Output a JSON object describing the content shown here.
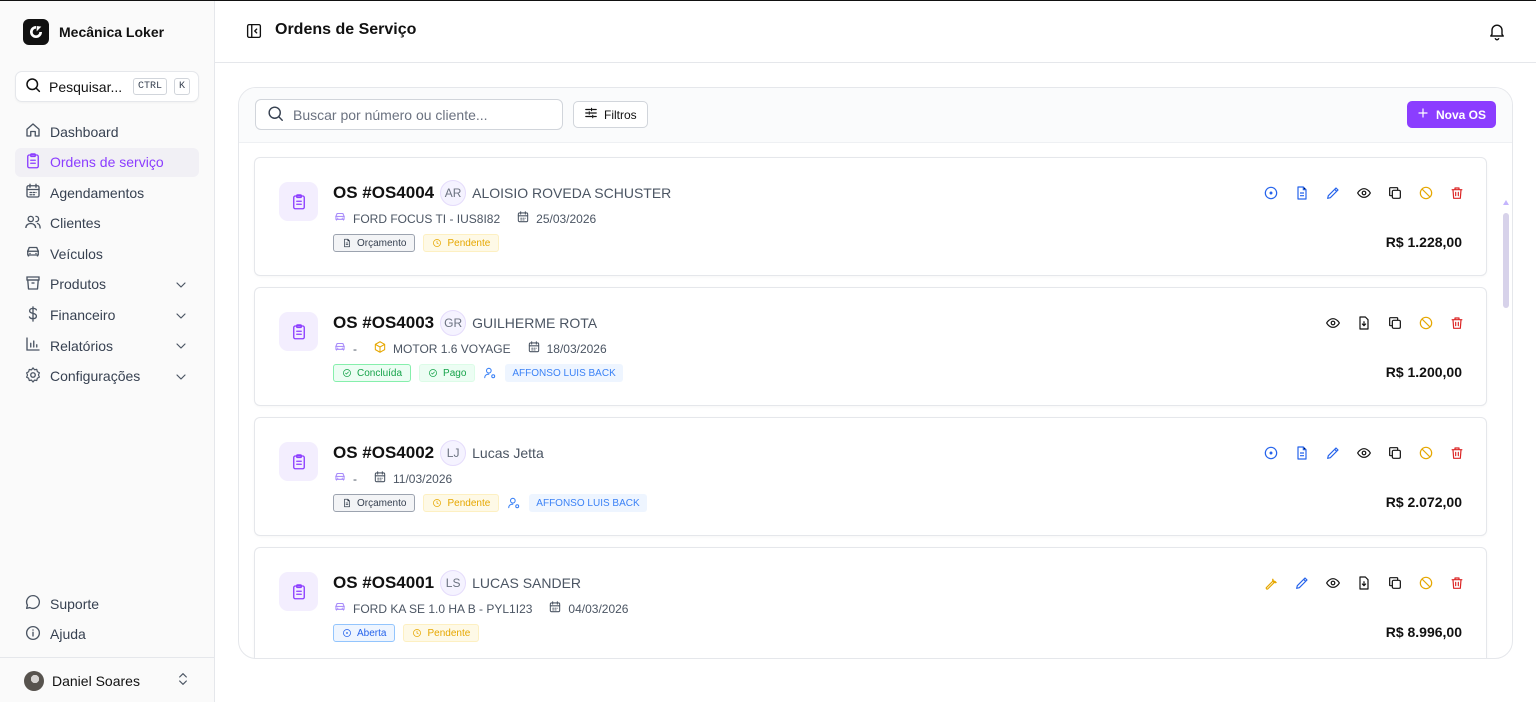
{
  "app": {
    "name": "Mecânica Loker"
  },
  "sidebar": {
    "search": {
      "label": "Pesquisar...",
      "kbd1": "CTRL",
      "kbd2": "K"
    },
    "items": [
      {
        "label": "Dashboard",
        "icon": "home-icon"
      },
      {
        "label": "Ordens de serviço",
        "icon": "clipboard-icon",
        "active": true
      },
      {
        "label": "Agendamentos",
        "icon": "calendar-icon"
      },
      {
        "label": "Clientes",
        "icon": "users-icon"
      },
      {
        "label": "Veículos",
        "icon": "car-icon"
      },
      {
        "label": "Produtos",
        "icon": "package-icon",
        "expandable": true
      },
      {
        "label": "Financeiro",
        "icon": "dollar-icon",
        "expandable": true
      },
      {
        "label": "Relatórios",
        "icon": "bar-chart-icon",
        "expandable": true
      },
      {
        "label": "Configurações",
        "icon": "settings-icon",
        "expandable": true
      }
    ],
    "bottom": [
      {
        "label": "Suporte",
        "icon": "message-icon"
      },
      {
        "label": "Ajuda",
        "icon": "info-icon"
      }
    ],
    "user": {
      "name": "Daniel Soares"
    }
  },
  "header": {
    "title": "Ordens de Serviço"
  },
  "toolbar": {
    "search_placeholder": "Buscar por número ou cliente...",
    "filters_label": "Filtros",
    "new_label": "Nova OS"
  },
  "colors": {
    "accent": "#8b3dff",
    "pending": "#e6a700",
    "success": "#16a34a",
    "info": "#2563eb",
    "danger": "#dc2626"
  },
  "orders": [
    {
      "number": "OS #OS4004",
      "initials": "AR",
      "client": "ALOISIO ROVEDA SCHUSTER",
      "vehicle": "FORD FOCUS TI - IUS8I82",
      "date": "25/03/2026",
      "status": "Orçamento",
      "payment": "Pendente",
      "total": "R$ 1.228,00"
    },
    {
      "number": "OS #OS4003",
      "initials": "GR",
      "client": "GUILHERME ROTA",
      "vehicle": "-",
      "item": "MOTOR 1.6 VOYAGE",
      "date": "18/03/2026",
      "status": "Concluída",
      "payment": "Pago",
      "technician": "AFFONSO LUIS BACK",
      "total": "R$ 1.200,00"
    },
    {
      "number": "OS #OS4002",
      "initials": "LJ",
      "client": "Lucas Jetta",
      "vehicle": "-",
      "date": "11/03/2026",
      "status": "Orçamento",
      "payment": "Pendente",
      "technician": "AFFONSO LUIS BACK",
      "total": "R$ 2.072,00"
    },
    {
      "number": "OS #OS4001",
      "initials": "LS",
      "client": "LUCAS SANDER",
      "vehicle": "FORD KA SE 1.0 HA B - PYL1I23",
      "date": "04/03/2026",
      "status": "Aberta",
      "payment": "Pendente",
      "total": "R$ 8.996,00"
    }
  ]
}
